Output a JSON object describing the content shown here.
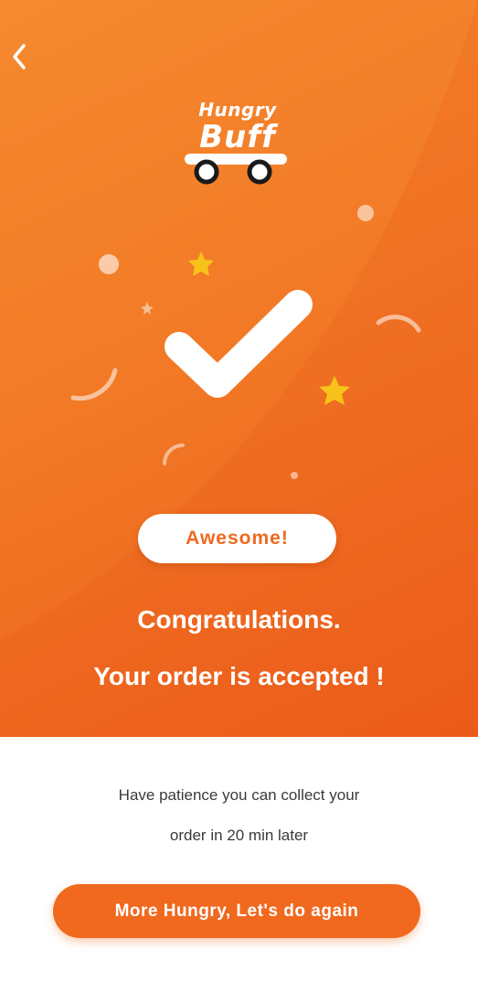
{
  "header": {
    "back_icon": "chevron-left-icon"
  },
  "logo": {
    "line1": "Hungry",
    "line2": "Buff",
    "icon": "cart-icon"
  },
  "illustration": {
    "icon": "checkmark-icon",
    "decorations": [
      "star-icon",
      "circle-dot",
      "arc"
    ],
    "colors": {
      "check": "#ffffff",
      "star": "#f7c31a"
    }
  },
  "status": {
    "badge": "Awesome!",
    "title": "Congratulations.",
    "subtitle": "Your order is accepted !"
  },
  "note": {
    "line1": "Have patience you can collect your",
    "line2": "order in 20 min later"
  },
  "actions": {
    "primary": "More Hungry, Let's do again"
  },
  "colors": {
    "accent": "#f0691f",
    "gradient_start": "#f58a30",
    "gradient_end": "#ec5d1a",
    "background": "#ffffff"
  }
}
